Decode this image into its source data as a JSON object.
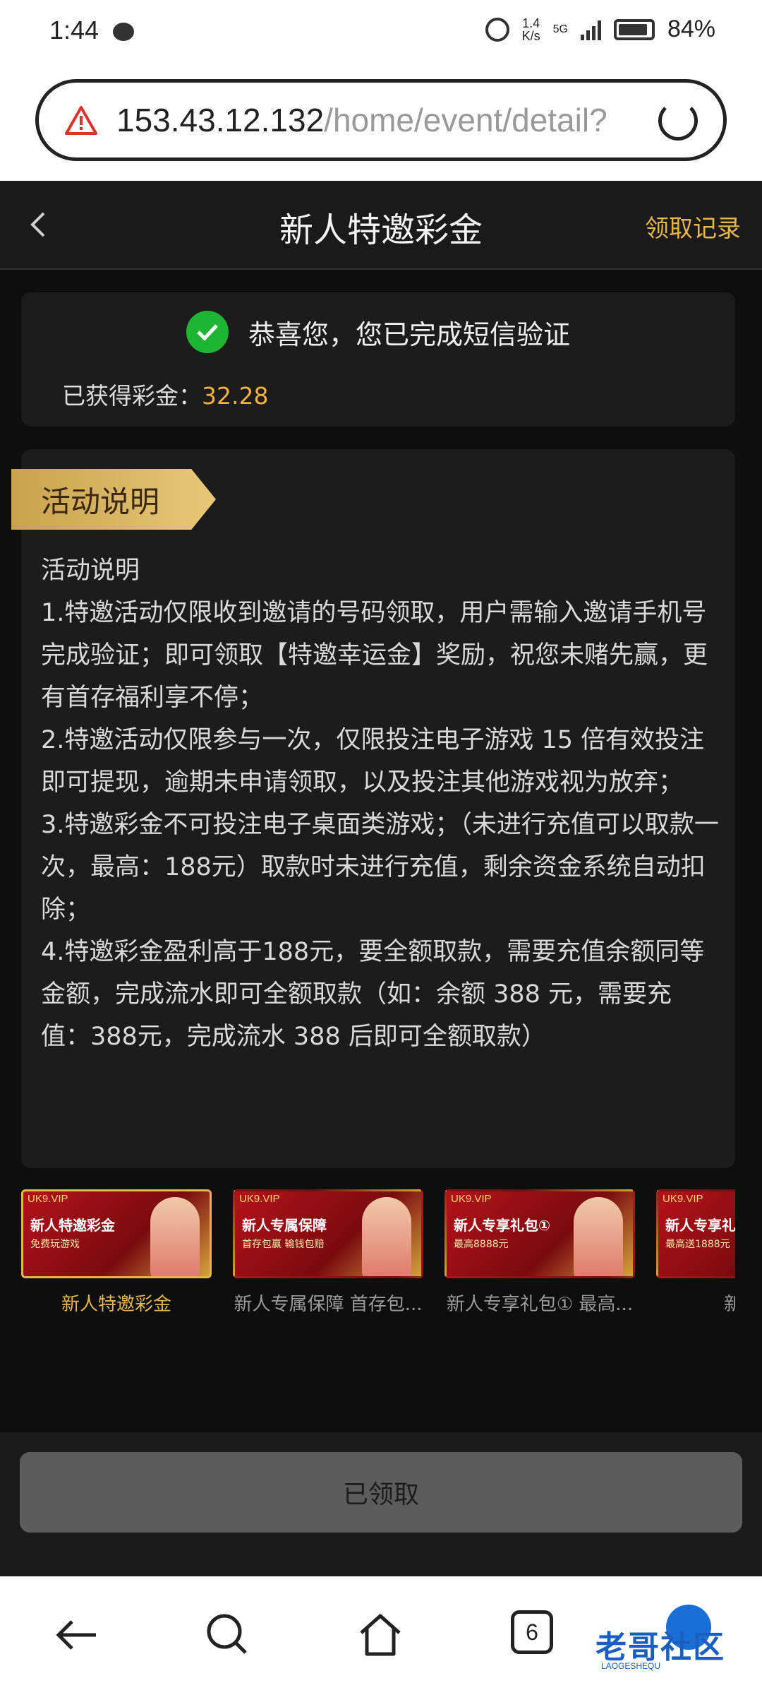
{
  "status_bar": {
    "time": "1:44",
    "net_speed_value": "1.4",
    "net_speed_unit": "K/s",
    "network": "5G",
    "battery": "84%"
  },
  "browser": {
    "url_host": "153.43.12.132",
    "url_path": "/home/event/detail?",
    "tab_count": "6"
  },
  "header": {
    "title": "新人特邀彩金",
    "records_link": "领取记录"
  },
  "verify_card": {
    "message": "恭喜您，您已完成短信验证",
    "earned_label": "已获得彩金：",
    "earned_amount": "32.28"
  },
  "description": {
    "ribbon": "活动说明",
    "heading": "活动说明",
    "rule1": "1.特邀活动仅限收到邀请的号码领取，用户需输入邀请手机号完成验证；即可领取【特邀幸运金】奖励，祝您未赌先赢，更有首存福利享不停；",
    "rule2": "2.特邀活动仅限参与一次，仅限投注电子游戏 15 倍有效投注即可提现，逾期未申请领取，以及投注其他游戏视为放弃；",
    "rule3": "3.特邀彩金不可投注电子桌面类游戏；（未进行充值可以取款一次，最高：188元）取款时未进行充值，剩余资金系统自动扣除；",
    "rule4": "4.特邀彩金盈利高于188元，要全额取款，需要充值余额同等金额，完成流水即可全额取款（如：余额 388 元，需要充值：388元，完成流水 388 后即可全额取款）"
  },
  "thumbnails": [
    {
      "brand": "UK9.VIP",
      "banner_title": "新人特邀彩金",
      "banner_sub": "免费玩游戏",
      "caption": "新人特邀彩金"
    },
    {
      "brand": "UK9.VIP",
      "banner_title": "新人专属保障",
      "banner_sub": "首存包赢 输钱包赔",
      "caption": "新人专属保障 首存包..."
    },
    {
      "brand": "UK9.VIP",
      "banner_title": "新人专享礼包①",
      "banner_sub": "最高8888元",
      "caption": "新人专享礼包① 最高..."
    },
    {
      "brand": "UK9.VIP",
      "banner_title": "新人专享礼包",
      "banner_sub": "最高送1888元",
      "caption": "新人专"
    }
  ],
  "footer": {
    "claimed_button": "已领取"
  },
  "watermark": {
    "text": "老哥社区",
    "sub": "LAOGESHEQU"
  },
  "colors": {
    "accent_gold": "#e3b54c",
    "amount_orange": "#f2b33d",
    "success_green": "#1fb533"
  }
}
